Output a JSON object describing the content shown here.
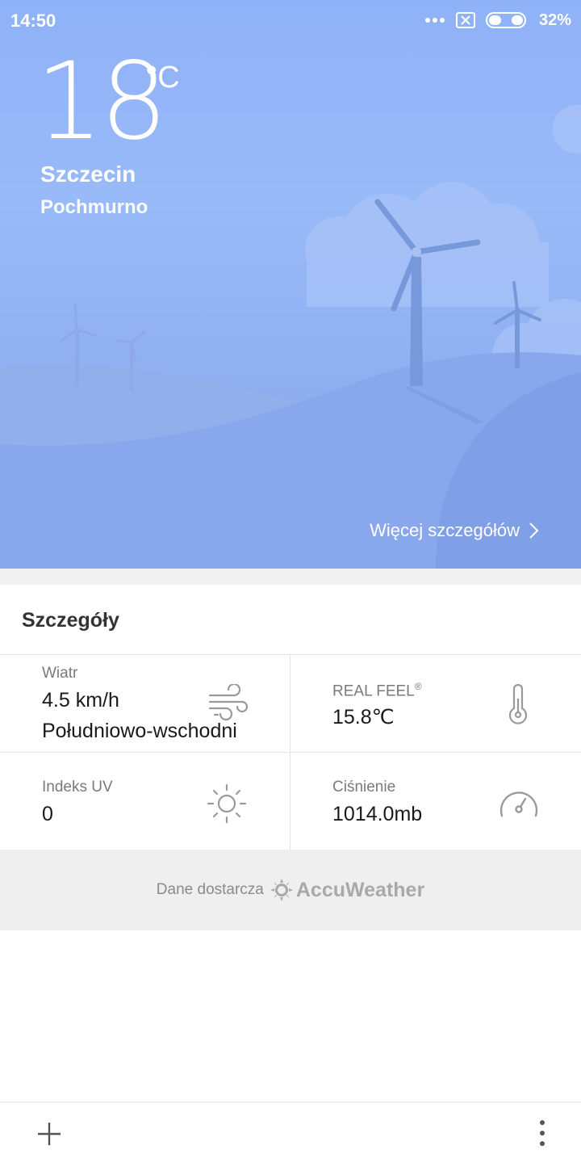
{
  "status_bar": {
    "time": "14:50",
    "battery_percent": "32%",
    "battery_level": 0.32
  },
  "current": {
    "temperature": "18",
    "unit": "°C",
    "city": "Szczecin",
    "condition": "Pochmurno",
    "more_link": "Więcej szczegółów"
  },
  "details": {
    "title": "Szczegóły",
    "wind": {
      "label": "Wiatr",
      "speed": "4.5 km/h",
      "direction": "Południowo-wschodni",
      "icon": "wind-icon"
    },
    "real_feel": {
      "label": "REAL FEEL",
      "mark": "®",
      "value": "15.8℃",
      "icon": "thermometer-icon"
    },
    "uv": {
      "label": "Indeks UV",
      "value": "0",
      "icon": "sun-icon"
    },
    "pressure": {
      "label": "Ciśnienie",
      "value": "1014.0mb",
      "icon": "gauge-icon"
    }
  },
  "credit": {
    "text": "Dane dostarcza",
    "logo": "AccuWeather"
  },
  "bottom_bar": {
    "add_icon": "plus-icon",
    "menu_icon": "more-vertical-icon"
  },
  "colors": {
    "sky_top": "#8fb1f7",
    "hill_front": "#7f9fe6",
    "text_dark": "#1a1a1a",
    "label_gray": "#7a7a7a"
  }
}
